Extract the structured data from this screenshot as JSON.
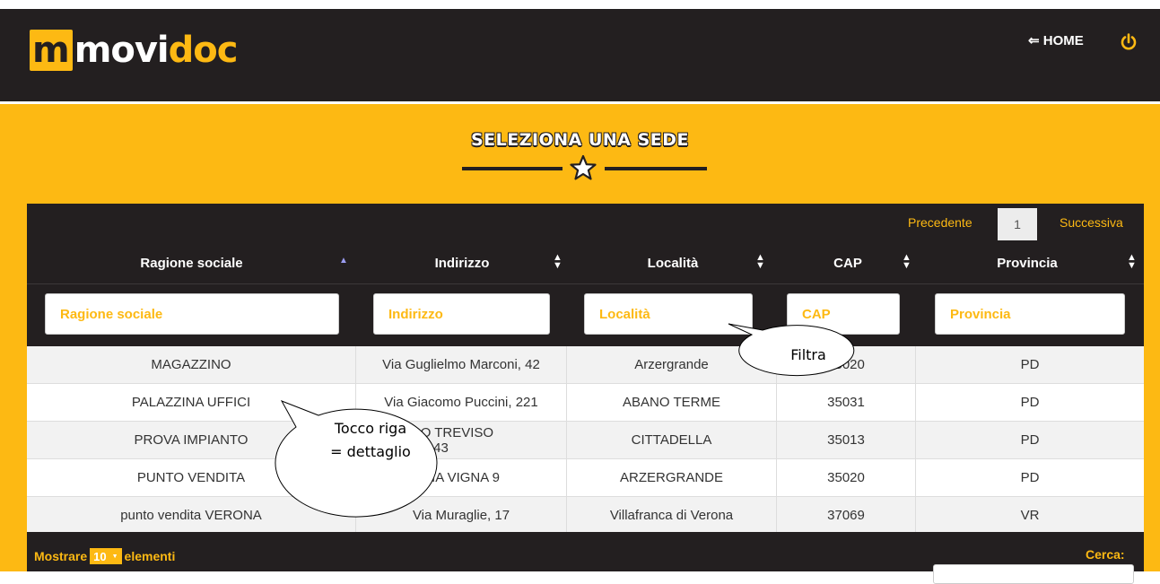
{
  "app": {
    "logo": {
      "m": "m",
      "movi": "movi",
      "doc": "doc"
    },
    "home_link": "⇐ HOME",
    "power_icon": "power-icon"
  },
  "page": {
    "title": "SELEZIONA UNA SEDE",
    "title_icon": "star-icon"
  },
  "pagination": {
    "prev": "Precedente",
    "current_page": "1",
    "next": "Successiva"
  },
  "table": {
    "columns": [
      "Ragione sociale",
      "Indirizzo",
      "Località",
      "CAP",
      "Provincia"
    ],
    "sorted_column": "Ragione sociale",
    "filter_placeholders": [
      "Ragione sociale",
      "Indirizzo",
      "Località",
      "CAP",
      "Provincia"
    ],
    "rows": [
      [
        "MAGAZZINO",
        "Via Guglielmo Marconi, 42",
        "Arzergrande",
        "35020",
        "PD"
      ],
      [
        "PALAZZINA UFFICI",
        "Via Giacomo Puccini, 221",
        "ABANO TERME",
        "35031",
        "PD"
      ],
      [
        "PROVA IMPIANTO",
        "VIA BORGO TREVISO GIUDICATO 43",
        "CITTADELLA",
        "35013",
        "PD"
      ],
      [
        "PUNTO VENDITA",
        "VIA VIGNA 9",
        "ARZERGRANDE",
        "35020",
        "PD"
      ],
      [
        "punto vendita VERONA",
        "Via Muraglie, 17",
        "Villafranca di Verona",
        "37069",
        "VR"
      ]
    ]
  },
  "footer": {
    "show_prefix": "Mostrare",
    "page_length": "10",
    "show_suffix": "elementi",
    "search_label": "Cerca:",
    "search_value": ""
  },
  "annotations": {
    "filter_callout": "Filtra",
    "row_callout_line1": "Tocco riga",
    "row_callout_line2": "= dettaglio"
  },
  "colors": {
    "accent": "#fdb913",
    "dark": "#231f20",
    "sort_active": "#9b9cf0"
  }
}
